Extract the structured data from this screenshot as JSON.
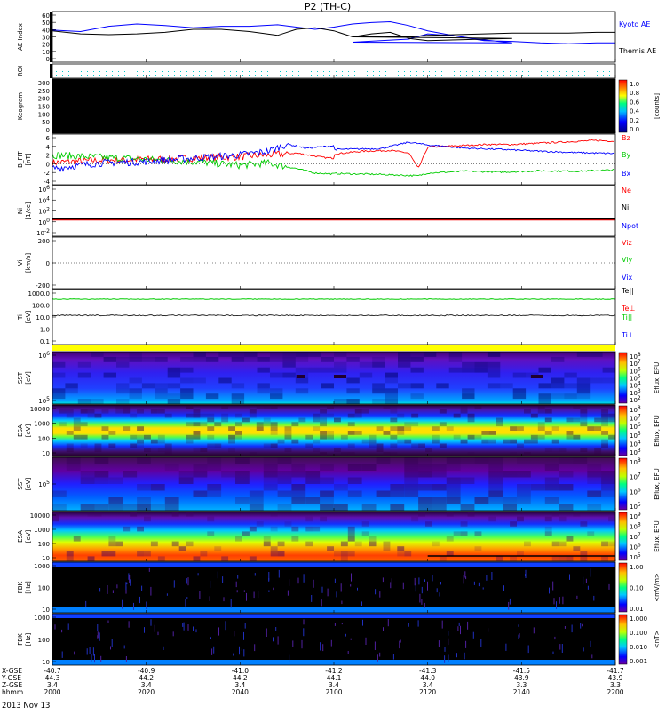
{
  "title": "P2 (TH-C)",
  "date_label": "2013 Nov 13",
  "colors": {
    "blue": "#0000ff",
    "red": "#ff0000",
    "green": "#00cc00",
    "black": "#000000",
    "cyan_dots": "#00c8c8",
    "yellow": "#ffff00"
  },
  "footer": {
    "row_labels": [
      "X-GSE",
      "Y-GSE",
      "Z-GSE",
      "hhmm"
    ],
    "rows": [
      [
        "-40.7",
        "-40.9",
        "-41.0",
        "-41.2",
        "-41.3",
        "-41.5",
        "-41.7"
      ],
      [
        "44.3",
        "44.2",
        "44.2",
        "44.1",
        "44.0",
        "43.9",
        "43.9"
      ],
      [
        "3.4",
        "3.4",
        "3.4",
        "3.4",
        "3.4",
        "3.3",
        "3.3"
      ],
      [
        "2000",
        "2020",
        "2040",
        "2100",
        "2120",
        "2140",
        "2200"
      ]
    ]
  },
  "panels": {
    "ae": {
      "ylabel": "AE Index",
      "ticks": [
        "60",
        "50",
        "40",
        "30",
        "20",
        "10",
        "0"
      ],
      "series": [
        {
          "name": "Kyoto AE",
          "color": "#0000ff",
          "x": [
            2000,
            2006,
            2012,
            2018,
            2024,
            2030,
            2036,
            2042,
            2048,
            2052,
            2056,
            2060,
            2064,
            2068,
            2072,
            2076,
            2080,
            2086,
            2092,
            2098,
            2104,
            2110,
            2116,
            2120,
            2126,
            2132,
            2138,
            2144,
            2150,
            2156,
            2160
          ],
          "y": [
            39,
            37,
            44,
            47,
            45,
            42,
            44,
            44,
            46,
            43,
            40,
            43,
            47,
            49,
            50,
            45,
            38,
            31,
            26,
            22,
            23,
            25,
            27,
            34,
            31,
            25,
            24,
            22,
            21,
            22,
            22
          ]
        },
        {
          "name": "Themis AE",
          "color": "#000000",
          "x": [
            2000,
            2006,
            2012,
            2018,
            2024,
            2030,
            2036,
            2042,
            2048,
            2052,
            2056,
            2060,
            2064,
            2068,
            2072,
            2076,
            2080,
            2086,
            2092,
            2098,
            2104,
            2110,
            2116,
            2120,
            2126,
            2132,
            2138,
            2144,
            2150,
            2156,
            2160
          ],
          "y": [
            38,
            34,
            33,
            34,
            36,
            40,
            40,
            37,
            32,
            40,
            42,
            38,
            30,
            34,
            36,
            28,
            25,
            26,
            27,
            28,
            30,
            31,
            30,
            32,
            33,
            34,
            35,
            35,
            35,
            36,
            36
          ]
        }
      ]
    },
    "roi": {
      "ylabel": "ROI"
    },
    "keogram": {
      "ylabel": "Keogram",
      "ticks": [
        "300",
        "250",
        "200",
        "150",
        "100",
        "50",
        "0"
      ],
      "colorbar_label": "[counts]",
      "colorbar_ticks": [
        "1.0",
        "0.8",
        "0.6",
        "0.4",
        "0.2",
        "0.0"
      ]
    },
    "bfield": {
      "ylabel": "B_FIT",
      "unit": "[nT]",
      "ticks": [
        "6",
        "4",
        "2",
        "0",
        "-2",
        "-4"
      ],
      "series": [
        {
          "name": "Bz",
          "color": "#ff0000",
          "x": [
            2000,
            2010,
            2020,
            2030,
            2040,
            2046,
            2052,
            2058,
            2064,
            2070,
            2076,
            2082,
            2088,
            2094,
            2100,
            2106,
            2112,
            2116,
            2118,
            2120,
            2126,
            2132,
            2138,
            2144,
            2150,
            2156,
            2160
          ],
          "y": [
            0.3,
            0.8,
            1.0,
            1.3,
            1.6,
            2.0,
            2.4,
            1.4,
            1.0,
            1.3,
            1.8,
            2.0,
            2.1,
            2.5,
            2.2,
            2.8,
            3.0,
            2.4,
            -1.0,
            3.7,
            4.0,
            4.3,
            4.3,
            4.6,
            4.9,
            5.2,
            5.0
          ]
        },
        {
          "name": "By",
          "color": "#00cc00",
          "x": [
            2000,
            2010,
            2020,
            2030,
            2040,
            2046,
            2052,
            2056,
            2062,
            2070,
            2080,
            2090,
            2100,
            2110,
            2118,
            2120,
            2128,
            2136,
            2144,
            2152,
            2160
          ],
          "y": [
            2.0,
            1.5,
            1.0,
            0.5,
            -0.3,
            0.2,
            -1.0,
            -2.0,
            -2.3,
            -2.2,
            -2.4,
            -2.3,
            -2.1,
            -2.3,
            -2.6,
            -2.0,
            -1.6,
            -1.8,
            -1.5,
            -1.6,
            -1.3
          ]
        },
        {
          "name": "Bx",
          "color": "#0000ff",
          "x": [
            2000,
            2010,
            2020,
            2030,
            2040,
            2046,
            2050,
            2054,
            2060,
            2070,
            2080,
            2090,
            2100,
            2110,
            2116,
            2120,
            2128,
            2136,
            2144,
            2152,
            2160
          ],
          "y": [
            -1.0,
            0.2,
            0.5,
            1.3,
            2.0,
            2.8,
            4.4,
            3.5,
            4.0,
            3.6,
            3.8,
            3.5,
            3.2,
            3.4,
            4.8,
            4.2,
            3.5,
            3.2,
            2.8,
            2.5,
            2.3
          ]
        }
      ]
    },
    "density": {
      "ylabel": "Ni",
      "unit": "[1/cc]",
      "ticks": [
        "10^6",
        "10^4",
        "10^2",
        "10^0",
        "10^-2"
      ],
      "legend": [
        {
          "name": "Ne",
          "color": "#ff0000"
        },
        {
          "name": "Ni",
          "color": "#000000"
        },
        {
          "name": "Npot",
          "color": "#0000ff"
        }
      ],
      "level_log10": 0.1
    },
    "velocity": {
      "ylabel": "Vi",
      "unit": "[km/s]",
      "ticks": [
        "200",
        "0",
        "-200"
      ],
      "legend": [
        {
          "name": "Viz",
          "color": "#ff0000"
        },
        {
          "name": "Viy",
          "color": "#00cc00"
        },
        {
          "name": "Vix",
          "color": "#0000ff"
        }
      ]
    },
    "temperature": {
      "ylabel": "Ti",
      "unit": "[eV]",
      "ticks": [
        "1000.0",
        "100.0",
        "10.0",
        "1.0",
        "0.1"
      ],
      "legend": [
        {
          "name": "Te||",
          "color": "#000000"
        },
        {
          "name": "Te⊥",
          "color": "#ff0000"
        },
        {
          "name": "Ti||",
          "color": "#00cc00"
        },
        {
          "name": "Ti⊥",
          "color": "#0000ff"
        }
      ],
      "green_level": 400,
      "black_level": 14
    },
    "sst_i": {
      "ylabel": "SST",
      "unit": "[eV]",
      "ticks": [
        "10^6",
        "10^5"
      ],
      "colorbar_label": "Eflux, EFU",
      "colorbar_ticks": [
        "10^8",
        "10^7",
        "10^6",
        "10^5",
        "10^4",
        "10^3",
        "10^2"
      ]
    },
    "esa_i": {
      "ylabel": "ESA",
      "unit": "[eV]",
      "ticks": [
        "10000",
        "1000",
        "100",
        "10"
      ],
      "colorbar_label": "Eflux, EFU",
      "colorbar_ticks": [
        "10^8",
        "10^7",
        "10^6",
        "10^5",
        "10^4",
        "10^3"
      ]
    },
    "sst_e": {
      "ylabel": "SST",
      "unit": "[eV]",
      "ticks": [
        "10^5"
      ],
      "colorbar_label": "Eflux, EFU",
      "colorbar_ticks": [
        "10^8",
        "10^7",
        "10^6",
        "10^5"
      ]
    },
    "esa_e": {
      "ylabel": "ESA",
      "unit": "[eV]",
      "ticks": [
        "10000",
        "1000",
        "100",
        "10"
      ],
      "colorbar_label": "Eflux, EFU",
      "colorbar_ticks": [
        "10^9",
        "10^8",
        "10^7",
        "10^6",
        "10^5"
      ]
    },
    "fbk_e": {
      "ylabel": "FBK",
      "unit": "[Hz]",
      "ticks": [
        "1000",
        "100",
        "10"
      ],
      "colorbar_label": "<mV/m>",
      "colorbar_ticks": [
        "1.00",
        "0.10",
        "0.01"
      ]
    },
    "fbk_b": {
      "ylabel": "FBK",
      "unit": "[Hz]",
      "ticks": [
        "1000",
        "100",
        "10"
      ],
      "colorbar_label": "<nT>",
      "colorbar_ticks": [
        "1.000",
        "0.100",
        "0.010",
        "0.001"
      ]
    }
  },
  "chart_data": {
    "type": "line",
    "title": "P2 (TH-C)",
    "x_range": [
      "2000",
      "2200"
    ],
    "x_tick_labels": [
      "2000",
      "2020",
      "2040",
      "2100",
      "2120",
      "2140",
      "2200"
    ],
    "panels": [
      {
        "name": "AE Index",
        "ylim": [
          0,
          60
        ],
        "series": [
          "Kyoto AE",
          "Themis AE"
        ]
      },
      {
        "name": "B_FIT",
        "ylim": [
          -4,
          6
        ],
        "series": [
          "Bz",
          "By",
          "Bx"
        ]
      },
      {
        "name": "Ni",
        "ylog": true,
        "series": [
          "Ne",
          "Ni",
          "Npot"
        ]
      },
      {
        "name": "Vi",
        "ylim": [
          -300,
          300
        ],
        "series": [
          "Viz",
          "Viy",
          "Vix"
        ]
      },
      {
        "name": "Ti",
        "ylog": true,
        "series": [
          "Te||",
          "Te⊥",
          "Ti||",
          "Ti⊥"
        ]
      }
    ]
  }
}
